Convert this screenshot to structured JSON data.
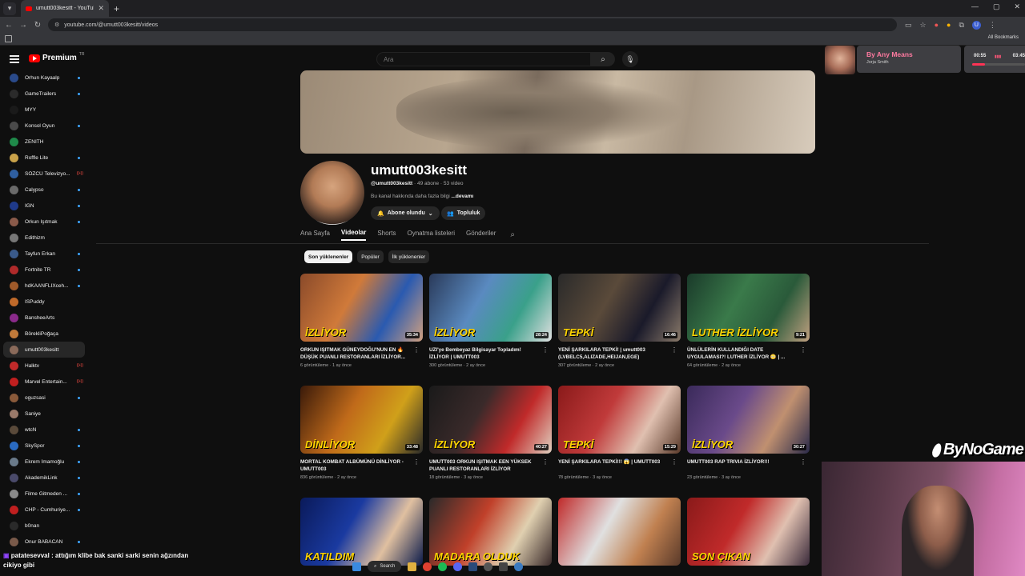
{
  "browser": {
    "tab_title": "umutt003kesitt - YouTube",
    "url": "youtube.com/@umutt003kesitt/videos",
    "bookmarks_label": "All Bookmarks",
    "profile_initial": "U"
  },
  "youtube": {
    "brand": "Premium",
    "brand_suffix": "TR",
    "search_placeholder": "Ara"
  },
  "sidebar": {
    "items": [
      {
        "label": "Orhun Kayaalp",
        "dot": true,
        "color": "#2a4a8a"
      },
      {
        "label": "GameTrailers",
        "dot": true,
        "color": "#2b2b2b"
      },
      {
        "label": "MYY",
        "dot": false,
        "color": "#1a1a1a"
      },
      {
        "label": "Konsol Oyun",
        "dot": true,
        "color": "#4a4a4a"
      },
      {
        "label": "ZENITH",
        "dot": false,
        "color": "#1f8a4a"
      },
      {
        "label": "Roffle Lite",
        "dot": true,
        "color": "#c9a24a"
      },
      {
        "label": "SÖZCÜ Televizyo...",
        "live": "((•))",
        "color": "#2f5fa0"
      },
      {
        "label": "Calypso",
        "dot": true,
        "color": "#6a6a6a"
      },
      {
        "label": "IGN",
        "dot": true,
        "color": "#1f3a8a"
      },
      {
        "label": "Orkun Işıtmak",
        "dot": true,
        "color": "#8a5a4a"
      },
      {
        "label": "Edithizm",
        "dot": false,
        "color": "#777"
      },
      {
        "label": "Tayfun Erkan",
        "dot": true,
        "color": "#3a5a8a"
      },
      {
        "label": "Fortnite TR",
        "dot": true,
        "color": "#b02a2a"
      },
      {
        "label": "hdKAANFLIXceh...",
        "dot": true,
        "color": "#a05a2a"
      },
      {
        "label": "ISPuddy",
        "dot": false,
        "color": "#c06a2a"
      },
      {
        "label": "BansheeArts",
        "dot": false,
        "color": "#8a2a8a"
      },
      {
        "label": "BörekliPoğaça",
        "dot": false,
        "color": "#c07a3a"
      },
      {
        "label": "umutt003kesitt",
        "dot": false,
        "color": "#8a6a5a",
        "active": true
      },
      {
        "label": "Halktv",
        "live": "((•))",
        "color": "#c02a2a"
      },
      {
        "label": "Marvel Entertain...",
        "live": "((•))",
        "color": "#c01f1f"
      },
      {
        "label": "oguzsasi",
        "dot": true,
        "color": "#8a5a3a"
      },
      {
        "label": "Saniye",
        "dot": false,
        "color": "#9a7a6a"
      },
      {
        "label": "wtcN",
        "dot": true,
        "color": "#5a4a3a"
      },
      {
        "label": "SkySpor",
        "dot": true,
        "color": "#2a6ac0"
      },
      {
        "label": "Ekrem İmamoğlu",
        "dot": true,
        "color": "#6a7a8a"
      },
      {
        "label": "AkademikLink",
        "dot": true,
        "color": "#4a4a6a"
      },
      {
        "label": "Filme Gitmeden ...",
        "dot": true,
        "color": "#8a8a8a"
      },
      {
        "label": "CHP - Cumhuriye...",
        "dot": true,
        "color": "#c01f1f"
      },
      {
        "label": "b0nan",
        "dot": false,
        "color": "#2a2a2a"
      },
      {
        "label": "Onur BABACAN",
        "dot": true,
        "color": "#7a5a4a"
      }
    ]
  },
  "channel": {
    "name": "umutt003kesitt",
    "handle": "@umutt003kesitt",
    "stats": "· 49 abone · 53 video",
    "desc": "Bu kanal hakkında daha fazla bilgi",
    "desc_more": "...devamı",
    "subscribed_label": "Abone olundu",
    "community_label": "Topluluk"
  },
  "tabs": [
    "Ana Sayfa",
    "Videolar",
    "Shorts",
    "Oynatma listeleri",
    "Gönderiler"
  ],
  "chips": [
    "Son yüklenenler",
    "Popüler",
    "İlk yüklenenler"
  ],
  "videos": [
    {
      "title": "ORKUN IŞITMAK GÜNEYDOĞU'NUN EN 🔥 DÜŞÜK PUANLI RESTORANLARI İZLİYOR...",
      "meta": "6 görüntüleme · 1 ay önce",
      "duration": "35:34",
      "overlay": "İZLİYOR",
      "bg": "linear-gradient(120deg,#8a4a2a,#d07a3a 40%,#2a5ab0 70%,#d0a080)"
    },
    {
      "title": "UZI'ye Bembeyaz Bilgisayar Topladım! İZLİYOR | UMUTT003",
      "meta": "300 görüntüleme · 2 ay önce",
      "duration": "28:24",
      "overlay": "İZLİYOR",
      "bg": "linear-gradient(120deg,#2a3a5a,#5a8ac0 40%,#3aa08a 70%,#e0e0e0)"
    },
    {
      "title": "YENİ ŞARKILARA TEPKİ! | umutt003 (LVBELC5,ALIZADE,HEIJAN,EGE)",
      "meta": "307 görüntüleme · 2 ay önce",
      "duration": "16:46",
      "overlay": "TEPKİ",
      "bg": "linear-gradient(120deg,#2a2a2a,#5a4a3a 40%,#1a1a2a 70%,#8a7a6a)"
    },
    {
      "title": "ÜNLÜLERİN KULLANDIĞI DATE UYGULAMASI?! LUTHER İZLİYOR 😳 | ...",
      "meta": "64 görüntüleme · 2 ay önce",
      "duration": "9:21",
      "overlay": "LUTHER İZLİYOR",
      "bg": "linear-gradient(120deg,#1a3a2a,#3a7a4a 40%,#2a5a3a 70%,#c0a080)"
    },
    {
      "title": "MORTAL KOMBAT ALBÜMÜNÜ DİNLİYOR - UMUTT003",
      "meta": "836 görüntüleme · 2 ay önce",
      "duration": "33:48",
      "overlay": "DİNLİYOR",
      "bg": "linear-gradient(120deg,#3a1a0a,#c06a1a 40%,#d0a01a 70%,#2a2a2a)"
    },
    {
      "title": "UMUTT003 ORKUN IŞITMAK EEN YÜKSEK PUANLI RESTORANLARI İZLİYOR",
      "meta": "18 görüntüleme · 3 ay önce",
      "duration": "40:27",
      "overlay": "İZLİYOR",
      "bg": "linear-gradient(120deg,#1a1a1a,#3a2a2a 40%,#c02a2a 70%,#e0d0c0)"
    },
    {
      "title": "YENİ ŞARKILARA TEPKİ!!! 😱 | UMUTT003",
      "meta": "78 görüntüleme · 3 ay önce",
      "duration": "15:29",
      "overlay": "TEPKİ",
      "bg": "linear-gradient(120deg,#8a1a1a,#c03a3a 40%,#e0c0b0 70%,#5a3a2a)"
    },
    {
      "title": "UMUTT003 RAP TRIVIA İZLİYOR!!!",
      "meta": "23 görüntüleme · 3 ay önce",
      "duration": "30:27",
      "overlay": "İZLİYOR",
      "bg": "linear-gradient(120deg,#3a2a5a,#6a4a8a 40%,#c09070 70%,#2a2a4a)"
    },
    {
      "title": "",
      "meta": "",
      "duration": "",
      "overlay": "KATILDIM",
      "bg": "linear-gradient(120deg,#0a1a5a,#1a3aa0 40%,#e0c0a0 70%,#0a1a4a)"
    },
    {
      "title": "",
      "meta": "",
      "duration": "",
      "overlay": "MADARA OLDUK",
      "bg": "linear-gradient(120deg,#2a2a2a,#c0402a 40%,#e0d0b0 70%,#3a2a2a)"
    },
    {
      "title": "",
      "meta": "",
      "duration": "",
      "overlay": "",
      "bg": "linear-gradient(120deg,#c02a2a,#e0e0e0 40%,#c08050 70%,#5a3a2a)"
    },
    {
      "title": "",
      "meta": "",
      "duration": "",
      "overlay": "SON ÇIKAN",
      "bg": "linear-gradient(120deg,#8a1a1a,#c02a2a 40%,#e0c0b0 70%,#3a2a3a)"
    }
  ],
  "media": {
    "song": "By Any Means",
    "artist": "Jorja Smith",
    "elapsed": "00:55",
    "total": "03:45",
    "progress": 0.24
  },
  "overlay": {
    "brand": "ByNoGame"
  },
  "chat": {
    "user": "patatesevval",
    "message": ": attığım klibe bak sanki sarki senin ağzından cikiyo gibi"
  },
  "taskbar": {
    "search_label": "Search"
  }
}
